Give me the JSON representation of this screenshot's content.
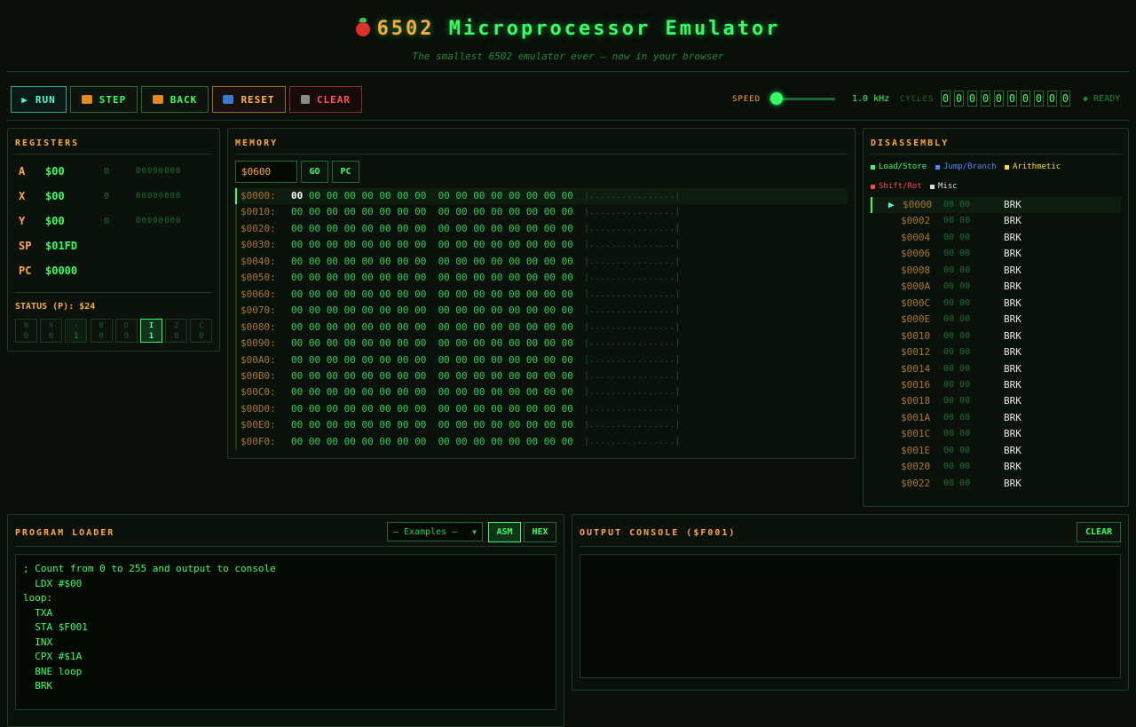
{
  "header": {
    "title_prefix": "6502",
    "title_rest": " Microprocessor Emulator",
    "subtitle": "The smallest 6502 emulator ever — now in your browser"
  },
  "toolbar": {
    "run": "RUN",
    "step": "STEP",
    "back": "BACK",
    "reset": "RESET",
    "clear": "CLEAR",
    "speed_label": "SPEED",
    "speed_value": "1.0 kHz",
    "speed_level": 0.05,
    "cycles_label": "CYCLES",
    "cycles_digits": [
      "0",
      "0",
      "0",
      "0",
      "0",
      "0",
      "0",
      "0",
      "0",
      "0"
    ],
    "status": "◆ READY"
  },
  "registers": {
    "title": "REGISTERS",
    "rows": [
      {
        "name": "A",
        "hex": "$00",
        "dec": "0",
        "bin": "00000000"
      },
      {
        "name": "X",
        "hex": "$00",
        "dec": "0",
        "bin": "00000000"
      },
      {
        "name": "Y",
        "hex": "$00",
        "dec": "0",
        "bin": "00000000"
      },
      {
        "name": "SP",
        "hex": "$01FD",
        "dec": "",
        "bin": ""
      },
      {
        "name": "PC",
        "hex": "$0000",
        "dec": "",
        "bin": ""
      }
    ],
    "status_label": "STATUS (P): $24",
    "flags": [
      {
        "name": "N",
        "val": "0",
        "state": "off"
      },
      {
        "name": "V",
        "val": "0",
        "state": "off"
      },
      {
        "name": "-",
        "val": "1",
        "state": "dim"
      },
      {
        "name": "B",
        "val": "0",
        "state": "off"
      },
      {
        "name": "D",
        "val": "0",
        "state": "off"
      },
      {
        "name": "I",
        "val": "1",
        "state": "on"
      },
      {
        "name": "Z",
        "val": "0",
        "state": "off"
      },
      {
        "name": "C",
        "val": "0",
        "state": "off"
      }
    ]
  },
  "memory": {
    "title": "MEMORY",
    "address_input": "$0600",
    "go": "GO",
    "pc": "PC",
    "rows": [
      {
        "addr": "$0000:",
        "first": "00",
        "rest": " 00 00 00 00 00 00 00  00 00 00 00 00 00 00 00",
        "ascii": "|................|"
      },
      {
        "addr": "$0010:",
        "first": "",
        "rest": "00 00 00 00 00 00 00 00  00 00 00 00 00 00 00 00",
        "ascii": "|................|"
      },
      {
        "addr": "$0020:",
        "first": "",
        "rest": "00 00 00 00 00 00 00 00  00 00 00 00 00 00 00 00",
        "ascii": "|................|"
      },
      {
        "addr": "$0030:",
        "first": "",
        "rest": "00 00 00 00 00 00 00 00  00 00 00 00 00 00 00 00",
        "ascii": "|................|"
      },
      {
        "addr": "$0040:",
        "first": "",
        "rest": "00 00 00 00 00 00 00 00  00 00 00 00 00 00 00 00",
        "ascii": "|................|"
      },
      {
        "addr": "$0050:",
        "first": "",
        "rest": "00 00 00 00 00 00 00 00  00 00 00 00 00 00 00 00",
        "ascii": "|................|"
      },
      {
        "addr": "$0060:",
        "first": "",
        "rest": "00 00 00 00 00 00 00 00  00 00 00 00 00 00 00 00",
        "ascii": "|................|"
      },
      {
        "addr": "$0070:",
        "first": "",
        "rest": "00 00 00 00 00 00 00 00  00 00 00 00 00 00 00 00",
        "ascii": "|................|"
      },
      {
        "addr": "$0080:",
        "first": "",
        "rest": "00 00 00 00 00 00 00 00  00 00 00 00 00 00 00 00",
        "ascii": "|................|"
      },
      {
        "addr": "$0090:",
        "first": "",
        "rest": "00 00 00 00 00 00 00 00  00 00 00 00 00 00 00 00",
        "ascii": "|................|"
      },
      {
        "addr": "$00A0:",
        "first": "",
        "rest": "00 00 00 00 00 00 00 00  00 00 00 00 00 00 00 00",
        "ascii": "|................|"
      },
      {
        "addr": "$00B0:",
        "first": "",
        "rest": "00 00 00 00 00 00 00 00  00 00 00 00 00 00 00 00",
        "ascii": "|................|"
      },
      {
        "addr": "$00C0:",
        "first": "",
        "rest": "00 00 00 00 00 00 00 00  00 00 00 00 00 00 00 00",
        "ascii": "|................|"
      },
      {
        "addr": "$00D0:",
        "first": "",
        "rest": "00 00 00 00 00 00 00 00  00 00 00 00 00 00 00 00",
        "ascii": "|................|"
      },
      {
        "addr": "$00E0:",
        "first": "",
        "rest": "00 00 00 00 00 00 00 00  00 00 00 00 00 00 00 00",
        "ascii": "|................|"
      },
      {
        "addr": "$00F0:",
        "first": "",
        "rest": "00 00 00 00 00 00 00 00  00 00 00 00 00 00 00 00",
        "ascii": "|................|"
      }
    ]
  },
  "disassembly": {
    "title": "DISASSEMBLY",
    "legend": [
      {
        "label": "Load/Store",
        "color": "#33ff66"
      },
      {
        "label": "Jump/Branch",
        "color": "#4488ff"
      },
      {
        "label": "Arithmetic",
        "color": "#ffdd33"
      },
      {
        "label": "Shift/Rot",
        "color": "#ff4444"
      },
      {
        "label": "Misc",
        "color": "#dddddd"
      }
    ],
    "current_marker": "▶",
    "rows": [
      {
        "addr": "$0000",
        "bytes": "00 00",
        "op": "BRK"
      },
      {
        "addr": "$0002",
        "bytes": "00 00",
        "op": "BRK"
      },
      {
        "addr": "$0004",
        "bytes": "00 00",
        "op": "BRK"
      },
      {
        "addr": "$0006",
        "bytes": "00 00",
        "op": "BRK"
      },
      {
        "addr": "$0008",
        "bytes": "00 00",
        "op": "BRK"
      },
      {
        "addr": "$000A",
        "bytes": "00 00",
        "op": "BRK"
      },
      {
        "addr": "$000C",
        "bytes": "00 00",
        "op": "BRK"
      },
      {
        "addr": "$000E",
        "bytes": "00 00",
        "op": "BRK"
      },
      {
        "addr": "$0010",
        "bytes": "00 00",
        "op": "BRK"
      },
      {
        "addr": "$0012",
        "bytes": "00 00",
        "op": "BRK"
      },
      {
        "addr": "$0014",
        "bytes": "00 00",
        "op": "BRK"
      },
      {
        "addr": "$0016",
        "bytes": "00 00",
        "op": "BRK"
      },
      {
        "addr": "$0018",
        "bytes": "00 00",
        "op": "BRK"
      },
      {
        "addr": "$001A",
        "bytes": "00 00",
        "op": "BRK"
      },
      {
        "addr": "$001C",
        "bytes": "00 00",
        "op": "BRK"
      },
      {
        "addr": "$001E",
        "bytes": "00 00",
        "op": "BRK"
      },
      {
        "addr": "$0020",
        "bytes": "00 00",
        "op": "BRK"
      },
      {
        "addr": "$0022",
        "bytes": "00 00",
        "op": "BRK"
      }
    ]
  },
  "loader": {
    "title": "PROGRAM LOADER",
    "examples": "— Examples —",
    "asm": "ASM",
    "hex": "HEX",
    "code": [
      "; Count from 0 to 255 and output to console",
      "  LDX #$00",
      "loop:",
      "  TXA",
      "  STA $F001",
      "  INX",
      "  CPX #$1A",
      "  BNE loop",
      "  BRK"
    ]
  },
  "console": {
    "title": "OUTPUT CONSOLE ($F001)",
    "clear": "CLEAR"
  },
  "colors": {
    "accent_green": "#33ff66",
    "accent_orange": "#ffaa33",
    "run_cyan": "#44ffcc",
    "clear_red": "#ff5555"
  }
}
